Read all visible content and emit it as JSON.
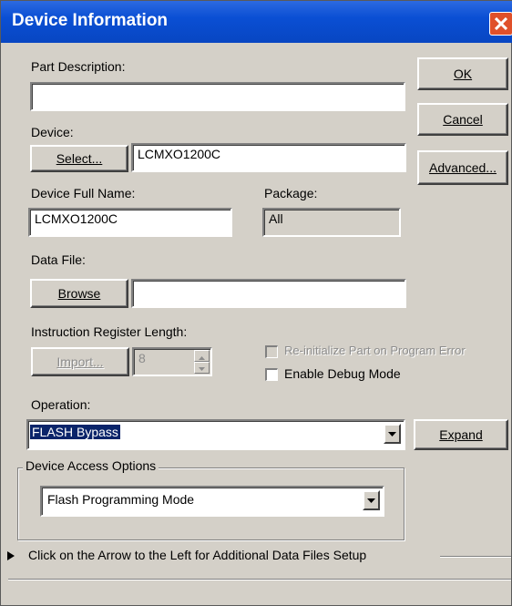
{
  "window": {
    "title": "Device Information"
  },
  "part_description": {
    "label": "Part Description:",
    "value": ""
  },
  "device": {
    "label": "Device:",
    "select_button": "Select...",
    "value": "LCMXO1200C"
  },
  "device_full_name": {
    "label": "Device Full Name:",
    "value": "LCMXO1200C"
  },
  "package": {
    "label": "Package:",
    "value": "All"
  },
  "data_file": {
    "label": "Data File:",
    "browse_button": "Browse",
    "value": ""
  },
  "instruction_register": {
    "label": "Instruction Register Length:",
    "import_button": "Import...",
    "value": "8"
  },
  "options": {
    "reinitialize_label": "Re-initialize Part on Program Error",
    "debug_label": "Enable Debug Mode"
  },
  "operation": {
    "label": "Operation:",
    "value": "FLASH Bypass",
    "expand_button": "Expand"
  },
  "device_access": {
    "group_label": "Device Access Options",
    "value": "Flash Programming Mode"
  },
  "additional_files": {
    "text": "Click on the Arrow to the Left for Additional Data Files Setup"
  },
  "buttons": {
    "ok": "OK",
    "cancel": "Cancel",
    "advanced": "Advanced..."
  },
  "colors": {
    "title_bar": "#0a4fd4",
    "window_bg": "#d4d0c8",
    "selection": "#0a246a",
    "close_button": "#e0502a"
  }
}
